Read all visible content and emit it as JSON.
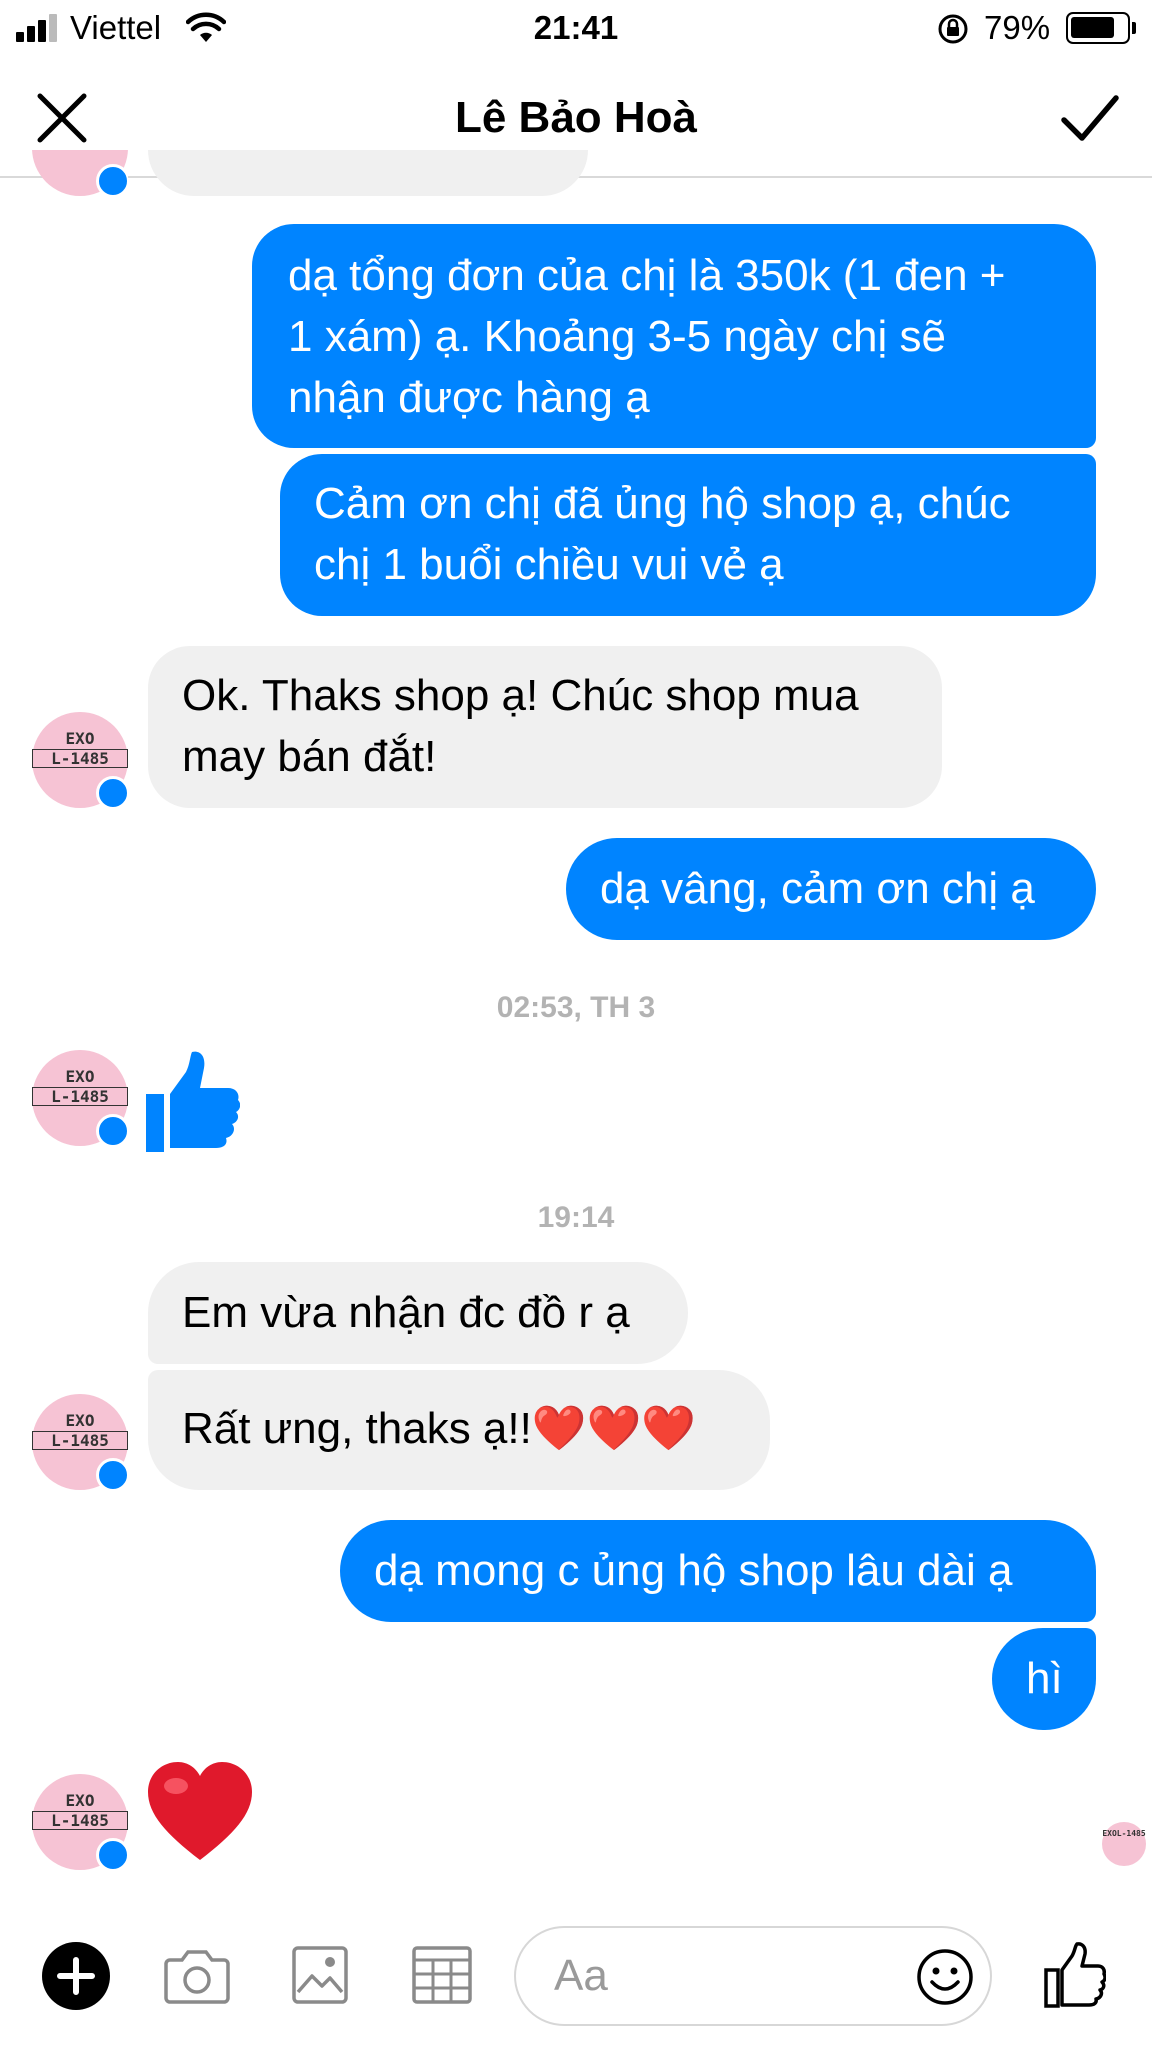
{
  "status_bar": {
    "carrier": "Viettel",
    "time": "21:41",
    "battery_percent": "79%",
    "battery_level": 0.79
  },
  "header": {
    "contact_name": "Lê Bảo Hoà",
    "close_icon": "close-icon",
    "done_icon": "checkmark-icon"
  },
  "avatar": {
    "line1": "EXO",
    "line2": "L-1485"
  },
  "messages": [
    {
      "from": "me",
      "lines": [
        "dạ tổng đơn của chị là 350k (1 đen +",
        "1 xám) ạ. Khoảng 3-5 ngày chị sẽ",
        "nhận được hàng ạ"
      ]
    },
    {
      "from": "me",
      "lines": [
        "Cảm ơn chị đã ủng hộ shop ạ, chúc",
        "chị 1 buổi chiều vui vẻ ạ"
      ]
    },
    {
      "from": "them",
      "lines": [
        "Ok. Thaks shop ạ! Chúc shop mua",
        "may bán đắt!"
      ]
    },
    {
      "from": "me",
      "lines": [
        "dạ vâng, cảm ơn chị ạ"
      ]
    },
    {
      "timestamp": "02:53, TH 3"
    },
    {
      "from": "them",
      "sticker": "thumbs-up-icon"
    },
    {
      "timestamp": "19:14"
    },
    {
      "from": "them",
      "lines": [
        "Em vừa nhận đc đồ r ạ"
      ]
    },
    {
      "from": "them",
      "lines": [
        "Rất ưng, thaks ạ!!"
      ],
      "emoji": "❤️❤️❤️"
    },
    {
      "from": "me",
      "lines": [
        "dạ mong c ủng hộ shop lâu dài ạ"
      ]
    },
    {
      "from": "me",
      "lines": [
        "hì"
      ]
    },
    {
      "from": "them",
      "emoji": "❤️"
    }
  ],
  "composer": {
    "placeholder": "Aa",
    "buttons": [
      "plus-icon",
      "camera-icon",
      "image-icon",
      "grid-icon",
      "emoji-icon",
      "like-icon"
    ]
  },
  "colors": {
    "outgoing": "#0084ff",
    "incoming": "#f0f0f0",
    "accent": "#0084ff"
  }
}
